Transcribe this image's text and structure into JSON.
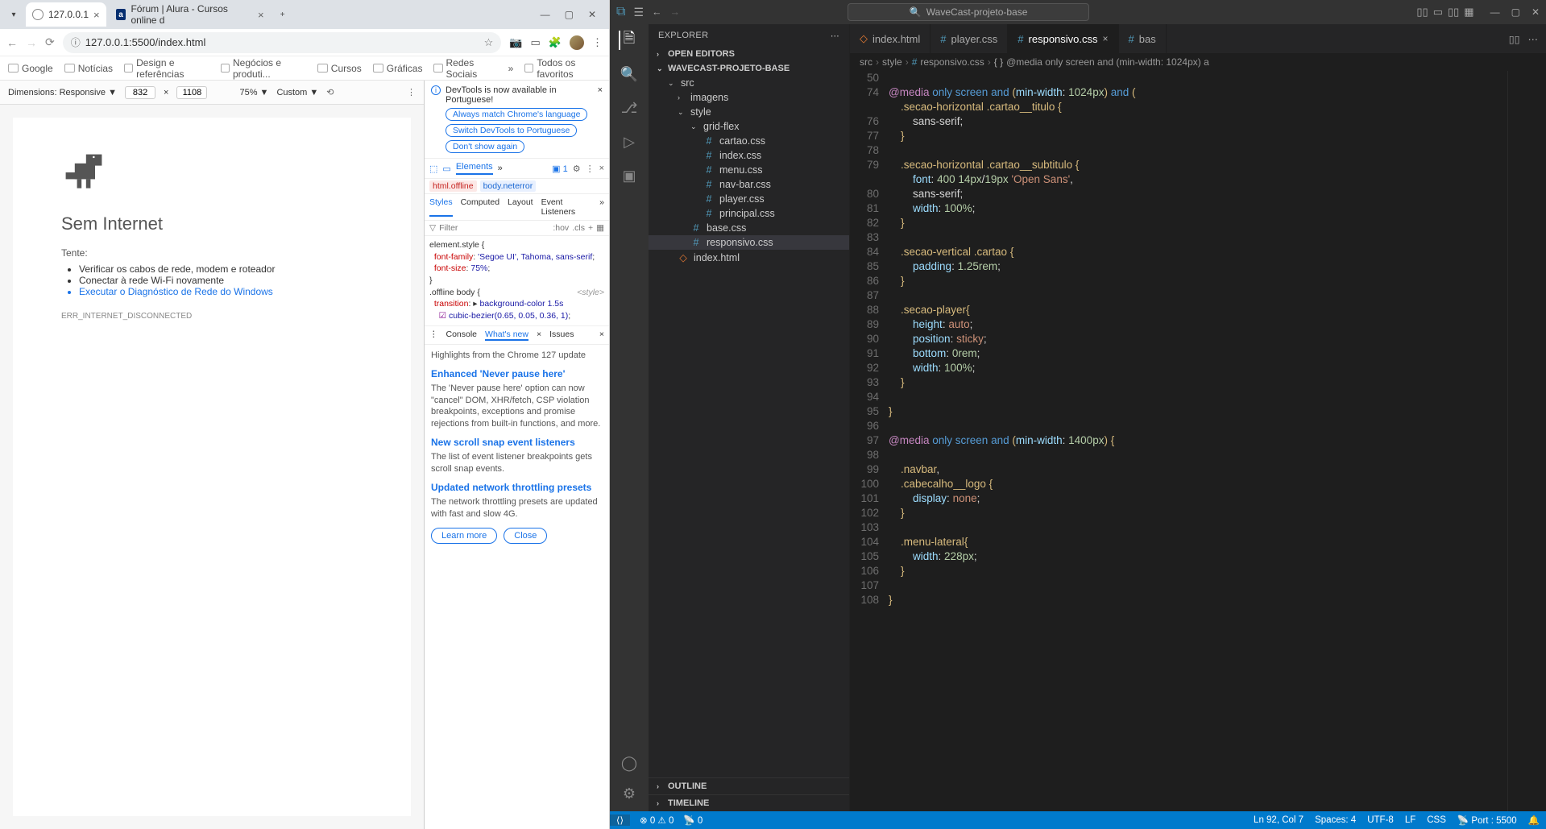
{
  "chrome": {
    "tab1": "127.0.0.1",
    "tab2": "Fórum | Alura - Cursos online d",
    "url": "127.0.0.1:5500/index.html",
    "bookmarks": [
      "Google",
      "Notícias",
      "Design e referências",
      "Negócios e produti...",
      "Cursos",
      "Gráficas",
      "Redes Sociais"
    ],
    "bm_all": "Todos os favoritos",
    "device": {
      "label": "Dimensions: Responsive",
      "w": "832",
      "h": "1108",
      "zoom": "75%",
      "custom": "Custom"
    },
    "page": {
      "title": "Sem Internet",
      "tente": "Tente:",
      "b1": "Verificar os cabos de rede, modem e roteador",
      "b2": "Conectar à rede Wi-Fi novamente",
      "b3": "Executar o Diagnóstico de Rede do Windows",
      "err": "ERR_INTERNET_DISCONNECTED"
    },
    "dt": {
      "banner": "DevTools is now available in Portuguese!",
      "chip1": "Always match Chrome's language",
      "chip2": "Switch DevTools to Portuguese",
      "chip3": "Don't show again",
      "elements": "Elements",
      "crumb1": "html.offline",
      "crumb2": "body.neterror",
      "sub": [
        "Styles",
        "Computed",
        "Layout",
        "Event Listeners"
      ],
      "filter": "Filter",
      "hov": ":hov",
      "cls": ".cls",
      "drawer": [
        "Console",
        "What's new",
        "Issues"
      ],
      "hl": "Highlights from the Chrome 127 update",
      "h1": "Enhanced 'Never pause here'",
      "p1": "The 'Never pause here' option can now \"cancel\" DOM, XHR/fetch, CSP violation breakpoints, exceptions and promise rejections from built-in functions, and more.",
      "h2": "New scroll snap event listeners",
      "p2": "The list of event listener breakpoints gets scroll snap events.",
      "h3": "Updated network throttling presets",
      "p3": "The network throttling presets are updated with fast and slow 4G.",
      "learn": "Learn more",
      "close": "Close",
      "style_el": "element.style {",
      "ff": "font-family",
      "ffv": "'Segoe UI', Tahoma, sans-serif",
      "fs": "font-size",
      "fsv": "75%",
      "offbody": ".offline body {",
      "style_lbl": "<style>",
      "trans": "transition",
      "transv": "background-color 1.5s",
      "bez": "cubic-bezier(0.65, 0.05, 0.36, 1)",
      "issue1": "1"
    }
  },
  "vs": {
    "title": "WaveCast-projeto-base",
    "explorer": "EXPLORER",
    "openEd": "OPEN EDITORS",
    "proj": "WAVECAST-PROJETO-BASE",
    "src": "src",
    "imagens": "imagens",
    "style": "style",
    "gridflex": "grid-flex",
    "files": {
      "cartao": "cartao.css",
      "index": "index.css",
      "menu": "menu.css",
      "navbar": "nav-bar.css",
      "player": "player.css",
      "principal": "principal.css",
      "base": "base.css",
      "responsivo": "responsivo.css",
      "indexhtml": "index.html"
    },
    "outline": "OUTLINE",
    "timeline": "TIMELINE",
    "tabs": {
      "index": "index.html",
      "player": "player.css",
      "responsivo": "responsivo.css",
      "bas": "bas"
    },
    "c_src": "src",
    "c_style": "style",
    "c_resp": "responsivo.css",
    "c_media": "@media only screen and (min-width: 1024px) a",
    "ln": [
      "50",
      "74",
      "",
      "76",
      "77",
      "78",
      "79",
      "",
      "80",
      "81",
      "82",
      "83",
      "84",
      "85",
      "86",
      "87",
      "88",
      "89",
      "90",
      "91",
      "92",
      "93",
      "94",
      "95",
      "96",
      "97",
      "98",
      "99",
      "100",
      "101",
      "102",
      "103",
      "104",
      "105",
      "106",
      "107",
      "108"
    ],
    "code": {
      "l50": "@media only screen and (min-width: 1024px) and (",
      "l74": ".secao-horizontal .cartao__titulo {",
      "l75": "sans-serif;",
      "l78": ".secao-horizontal .cartao__subtitulo {",
      "l79a": "font",
      "l79b": ": 400 14px/19px 'Open Sans',",
      "l79c": "sans-serif;",
      "l80a": "width",
      "l80b": ": 100%;",
      "l83": ".secao-vertical .cartao {",
      "l84a": "padding",
      "l84b": ": 1.25rem;",
      "l87": ".secao-player{",
      "l88a": "height",
      "l88b": ": auto;",
      "l89a": "position",
      "l89b": ": sticky;",
      "l90a": "bottom",
      "l90b": ": 0rem;",
      "l91a": "width",
      "l91b": ": 100%;",
      "l96": "@media only screen and (min-width: 1400px) {",
      "l98": ".navbar,",
      "l99": ".cabecalho__logo {",
      "l100a": "display",
      "l100b": ": none;",
      "l103": ".menu-lateral{",
      "l104a": "width",
      "l104b": ": 228px;"
    },
    "status": {
      "err": "0",
      "warn": "0",
      "port0": "0",
      "pos": "Ln 92, Col 7",
      "spaces": "Spaces: 4",
      "enc": "UTF-8",
      "eol": "LF",
      "lang": "CSS",
      "port": "Port : 5500"
    }
  }
}
